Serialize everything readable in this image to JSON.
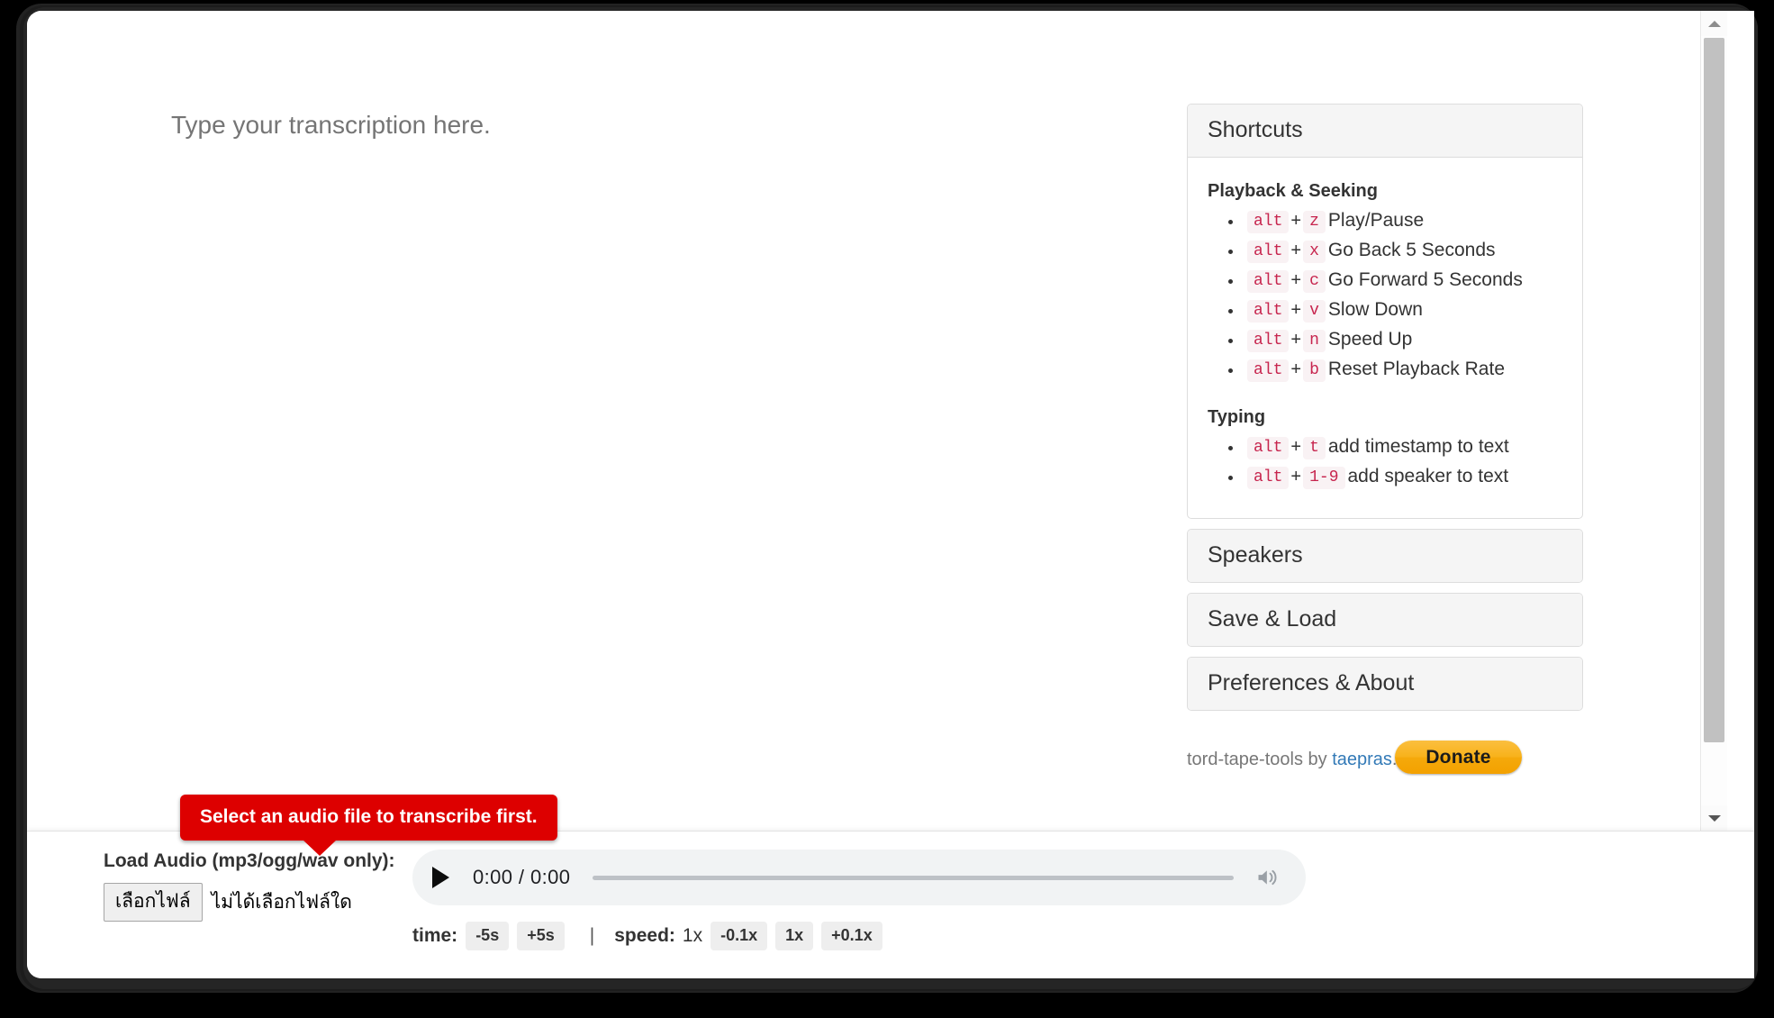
{
  "editor": {
    "placeholder": "Type your transcription here.",
    "value": ""
  },
  "sidebar": {
    "panels": [
      {
        "title": "Shortcuts",
        "expanded": true
      },
      {
        "title": "Speakers",
        "expanded": false
      },
      {
        "title": "Save & Load",
        "expanded": false
      },
      {
        "title": "Preferences & About",
        "expanded": false
      }
    ],
    "shortcuts": {
      "groups": [
        {
          "title": "Playback & Seeking",
          "items": [
            {
              "mod": "alt",
              "plus": "+",
              "key": "z",
              "desc": "Play/Pause"
            },
            {
              "mod": "alt",
              "plus": "+",
              "key": "x",
              "desc": "Go Back 5 Seconds"
            },
            {
              "mod": "alt",
              "plus": "+",
              "key": "c",
              "desc": "Go Forward 5 Seconds"
            },
            {
              "mod": "alt",
              "plus": "+",
              "key": "v",
              "desc": "Slow Down"
            },
            {
              "mod": "alt",
              "plus": "+",
              "key": "n",
              "desc": "Speed Up"
            },
            {
              "mod": "alt",
              "plus": "+",
              "key": "b",
              "desc": "Reset Playback Rate"
            }
          ]
        },
        {
          "title": "Typing",
          "items": [
            {
              "mod": "alt",
              "plus": "+",
              "key": "t",
              "desc": "add timestamp to text"
            },
            {
              "mod": "alt",
              "plus": "+",
              "key": "1-9",
              "desc": "add speaker to text"
            }
          ]
        }
      ]
    },
    "footer": {
      "credit_prefix": "tord-tape-tools by ",
      "credit_link": "taepras",
      "credit_suffix": ".",
      "donate_label": "Donate",
      "donate_color": "#f8b21c",
      "link_color": "#337ab7"
    }
  },
  "bottom_bar": {
    "tooltip": {
      "text": "Select an audio file to transcribe first.",
      "color": "#dd0000"
    },
    "load_audio_label": "Load Audio (mp3/ogg/wav only):",
    "choose_file_button": "เลือกไฟล์",
    "no_file_text": "ไม่ได้เลือกไฟล์ใด",
    "player": {
      "play_icon": "play-icon",
      "time_display": "0:00 / 0:00",
      "current_time": "0:00",
      "duration": "0:00",
      "progress_percent": 0,
      "volume_icon": "volume-high-icon"
    },
    "transport": {
      "time_label": "time:",
      "time_buttons": [
        "-5s",
        "+5s"
      ],
      "separator": "|",
      "speed_label": "speed:",
      "speed_value": "1x",
      "speed_buttons": [
        "-0.1x",
        "1x",
        "+0.1x"
      ]
    }
  },
  "scrollbar": {
    "up_icon": "chevron-up-icon",
    "down_icon": "chevron-down-icon",
    "thumb_position_percent": 0
  }
}
